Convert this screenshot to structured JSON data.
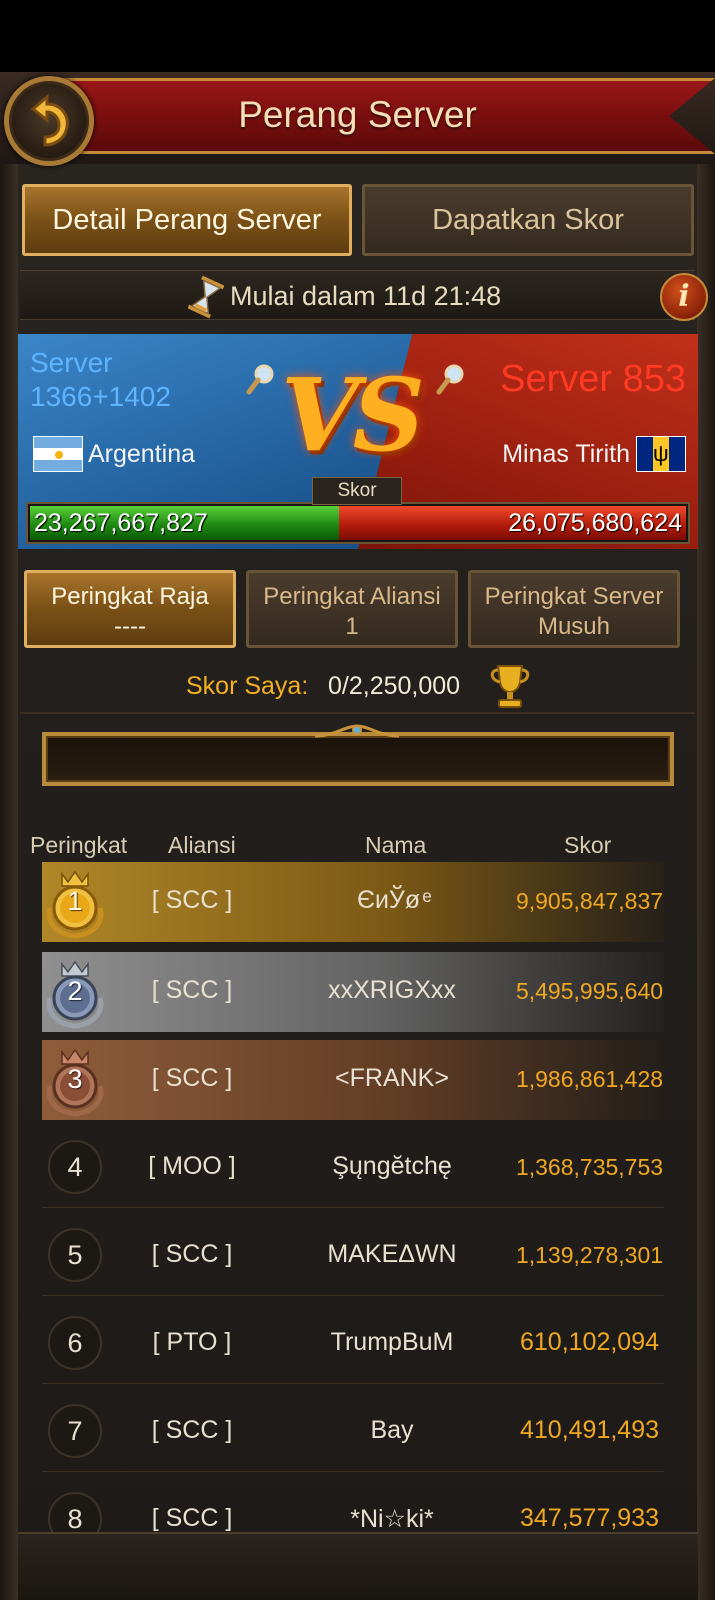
{
  "header": {
    "title": "Perang Server"
  },
  "tabs": {
    "detail": "Detail Perang Server",
    "get_score": "Dapatkan Skor"
  },
  "timer": {
    "text": "Mulai dalam 11d 21:48"
  },
  "vs": {
    "left_server": "Server 1366+1402",
    "left_server_line1": "Server",
    "left_server_line2": "1366+1402",
    "left_name": "Argentina",
    "right_server": "Server 853",
    "right_name": "Minas Tirith",
    "vs_text": "VS",
    "score_label": "Skor",
    "left_score": "23,267,667,827",
    "right_score": "26,075,680,624",
    "left_share": 0.4715,
    "colors": {
      "left": "#5fb4ff",
      "right": "#ff3a24"
    }
  },
  "rank_tabs": {
    "raja_label": "Peringkat Raja",
    "raja_value": "----",
    "aliansi_label": "Peringkat Aliansi",
    "aliansi_value": "1",
    "musuh_line1": "Peringkat Server",
    "musuh_line2": "Musuh"
  },
  "my_score": {
    "label": "Skor Saya",
    "separator": ":",
    "value": "0/2,250,000"
  },
  "table": {
    "headers": {
      "rank": "Peringkat",
      "alliance": "Aliansi",
      "name": "Nama",
      "score": "Skor"
    },
    "rows": [
      {
        "rank": "1",
        "alliance": "[ SCC ]",
        "name": "ЄиЎø ͤ",
        "score": "9,905,847,837"
      },
      {
        "rank": "2",
        "alliance": "[ SCC ]",
        "name": "xxXRIGXxx",
        "score": "5,495,995,640"
      },
      {
        "rank": "3",
        "alliance": "[ SCC ]",
        "name": "<FRANK>",
        "score": "1,986,861,428"
      },
      {
        "rank": "4",
        "alliance": "[ MOO ]",
        "name": "Şųngĕtchę",
        "score": "1,368,735,753"
      },
      {
        "rank": "5",
        "alliance": "[ SCC ]",
        "name": "MAKEΔWN",
        "score": "1,139,278,301"
      },
      {
        "rank": "6",
        "alliance": "[ PTO ]",
        "name": "TrumpBuM",
        "score": "610,102,094"
      },
      {
        "rank": "7",
        "alliance": "[ SCC ]",
        "name": "Bay",
        "score": "410,491,493"
      },
      {
        "rank": "8",
        "alliance": "[ SCC ]",
        "name": "*Ni☆ki*",
        "score": "347,577,933"
      }
    ]
  },
  "icons": {
    "back": "back-arrow-icon",
    "hourglass": "hourglass-icon",
    "info": "info-icon",
    "search": "magnifier-icon",
    "trophy": "trophy-icon",
    "medals": [
      "gold-medal-icon",
      "silver-medal-icon",
      "bronze-medal-icon"
    ]
  },
  "info_glyph": "i"
}
